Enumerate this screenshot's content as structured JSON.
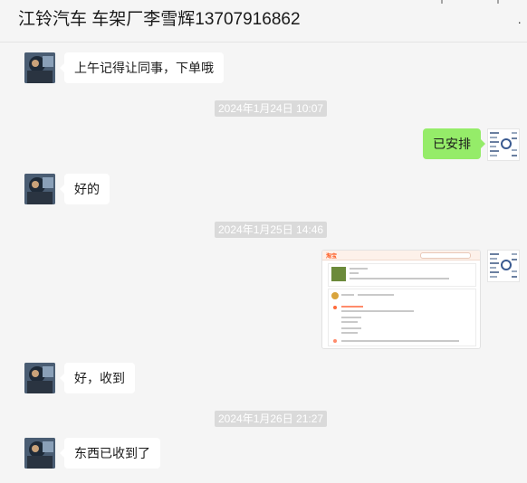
{
  "header": {
    "title": "江铃汽车 车架厂李雪辉13707916862",
    "more_label": "·"
  },
  "messages": {
    "m1": {
      "text": "上午记得让同事，下单哦"
    },
    "t1": {
      "text": "2024年1月24日 10:07"
    },
    "m2": {
      "text": "已安排"
    },
    "m3": {
      "text": "好的"
    },
    "t2": {
      "text": "2024年1月25日 14:46"
    },
    "m4": {
      "logo_text": "淘宝"
    },
    "m5": {
      "text": "好，收到"
    },
    "t3": {
      "text": "2024年1月26日 21:27"
    },
    "m6": {
      "text": "东西已收到了"
    }
  },
  "colors": {
    "self_bubble": "#95ec69",
    "other_bubble": "#ffffff",
    "background": "#f5f5f5",
    "timestamp_bg": "#dadada",
    "taobao_orange": "#ff5a1f"
  },
  "icons": {
    "contact_avatar": "avatar-photo",
    "self_avatar": "qr-code-avatar",
    "more": "more-dots-icon"
  }
}
